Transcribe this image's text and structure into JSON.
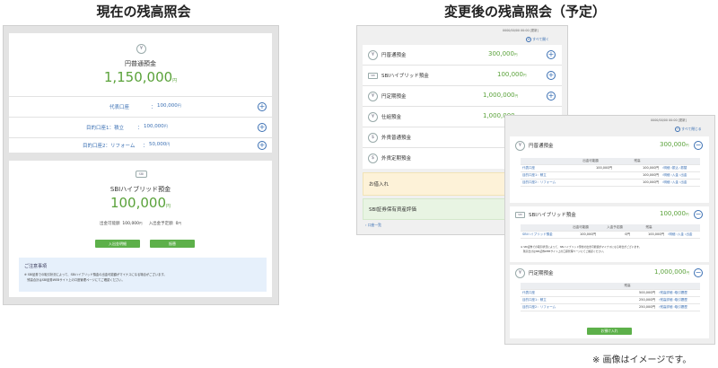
{
  "headers": {
    "current": "現在の残高照会",
    "future": "変更後の残高照会（予定）"
  },
  "current": {
    "yen": {
      "icon": "¥",
      "title": "円普通預金",
      "amount": "1,150,000",
      "unit": "円",
      "rows": [
        {
          "label": "代表口座",
          "value": "100,000",
          "unit": "円"
        },
        {
          "label": "目的口座1：積立",
          "value": "100,000",
          "unit": "円"
        },
        {
          "label": "目的口座2：リフォーム",
          "value": "50,000",
          "unit": "円"
        }
      ]
    },
    "hybrid": {
      "icon": "SBI",
      "title": "SBIハイブリッド預金",
      "amount": "100,000",
      "unit": "円",
      "sub1_label": "出金可能額",
      "sub1_value": "100,000",
      "sub2_label": "入出金予定額",
      "sub2_value": "0",
      "btn_history": "入出金明細",
      "btn_cancel": "振替"
    },
    "notice": {
      "title": "ご注意事項",
      "line1": "※ SBI証券での取引状況によって、SBIハイブリッド預金の出金可能額がマイナスになる場合がございます。",
      "line2": "　残高合計はSBI証券WEBサイト上の口座管理ページにてご確認ください。"
    }
  },
  "future": {
    "back": {
      "timestamp": "0000/00/00 00:00 [更新]",
      "toggle": "すべて開く",
      "items": [
        {
          "icon": "¥",
          "label": "円普通預金",
          "amount": "300,000",
          "unit": "円"
        },
        {
          "icon": "SBI",
          "label": "SBIハイブリッド預金",
          "amount": "100,000",
          "unit": "円"
        },
        {
          "icon": "¥",
          "label": "円定期預金",
          "amount": "1,000,000",
          "unit": "円"
        },
        {
          "icon": "¥",
          "label": "仕組預金",
          "amount": "1,000,000",
          "unit": "円"
        },
        {
          "icon": "$",
          "label": "外貨普通預金",
          "amount": "",
          "unit": ""
        },
        {
          "icon": "$",
          "label": "外貨定期預金",
          "amount": "",
          "unit": ""
        }
      ],
      "loan": "お借入れ",
      "securities": "SBI証券保有資産評価",
      "back_link": "口座一覧"
    },
    "front": {
      "timestamp": "0000/00/00 00:00 [更新]",
      "toggle": "すべて閉じる",
      "yen": {
        "title": "円普通預金",
        "amount": "300,000",
        "unit": "円",
        "cols": [
          "",
          "出金可能額",
          "残高",
          ""
        ],
        "rows": [
          {
            "name": "代表口座",
            "avail": "100,000円",
            "bal": "100,000円",
            "ops": "›明細 ›振込 ›振替"
          },
          {
            "name": "目的口座1：積立",
            "avail": "",
            "bal": "100,000円",
            "ops": "›明細 ›入金 ›出金"
          },
          {
            "name": "目的口座2：リフォーム",
            "avail": "",
            "bal": "100,000円",
            "ops": "›明細 ›入金 ›出金"
          }
        ]
      },
      "hybrid": {
        "title": "SBIハイブリッド預金",
        "amount": "100,000",
        "unit": "円",
        "cols": [
          "",
          "出金可能額",
          "入金予定額",
          "残高",
          ""
        ],
        "row": {
          "name": "SBIハイブリッド預金",
          "avail": "100,000円",
          "sched": "0円",
          "bal": "100,000円",
          "ops": "›明細 ›入金 ›出金"
        },
        "note1": "※ SBI証券での取引状況によって、SBIハイブリッド預金の出金可能額がマイナスになる場合がございます。",
        "note2": "　残高合計はSBI証券WEBサイト上の口座管理ページにてご確認ください。"
      },
      "fixed": {
        "title": "円定期預金",
        "amount": "1,000,000",
        "unit": "円",
        "cols": [
          "",
          "残高",
          ""
        ],
        "rows": [
          {
            "name": "代表口座",
            "bal": "500,000円",
            "ops": "›残高詳細 ›取引履歴"
          },
          {
            "name": "目的口座1：積立",
            "bal": "250,000円",
            "ops": "›残高詳細 ›取引履歴"
          },
          {
            "name": "目的口座2：リフォーム",
            "bal": "250,000円",
            "ops": "›残高詳細 ›取引履歴"
          }
        ],
        "btn": "お預け入れ"
      }
    }
  },
  "footnote": "※ 画像はイメージです。"
}
